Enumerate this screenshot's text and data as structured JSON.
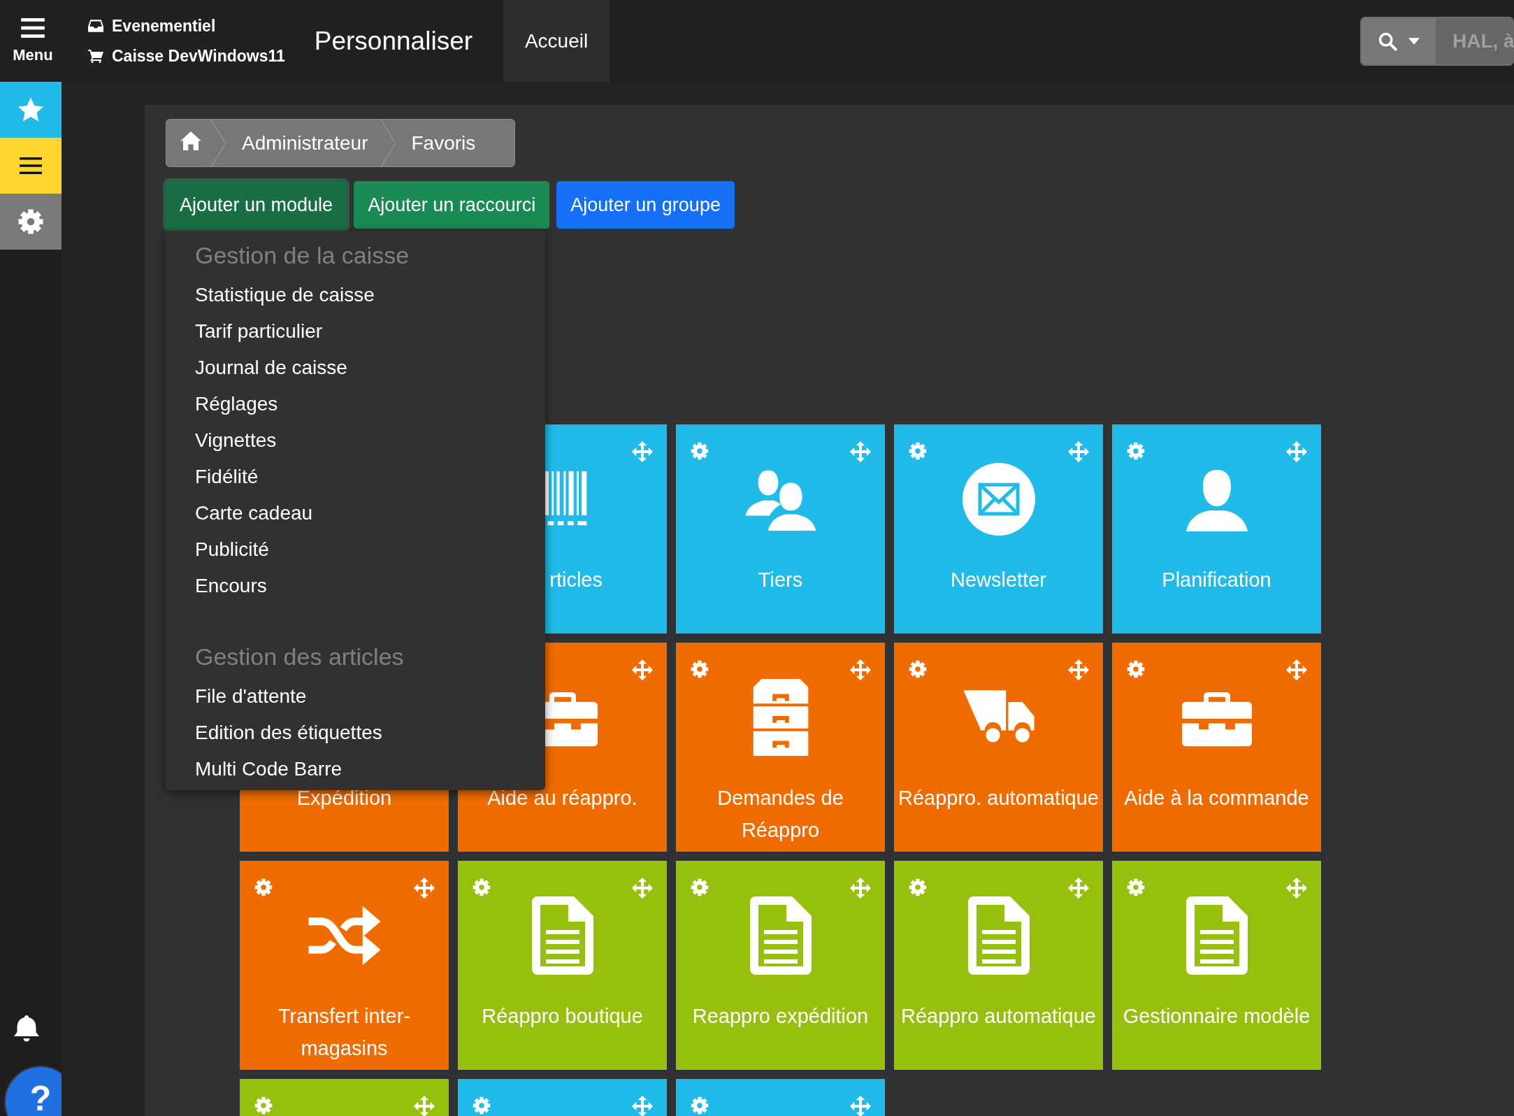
{
  "topbar": {
    "menu_label": "Menu",
    "context": [
      {
        "kind": "inbox",
        "text": "Evenementiel"
      },
      {
        "kind": "cart",
        "text": "Caisse DevWindows11"
      }
    ],
    "title": "Personnaliser",
    "tab": "Accueil",
    "search": {
      "placeholder": "HAL, à"
    }
  },
  "sidebar": {
    "items": [
      {
        "kind": "star",
        "color": "#20bbe8"
      },
      {
        "kind": "menu",
        "color": "#fed531"
      },
      {
        "kind": "gear",
        "color": "#7a7a7a"
      }
    ],
    "help": "?"
  },
  "breadcrumb": [
    "Administrateur",
    "Favoris"
  ],
  "buttons": [
    {
      "label": "Ajouter un module",
      "color": "#1a6e45",
      "selected": true
    },
    {
      "label": "Ajouter un raccourci",
      "color": "#1b8a55",
      "selected": false
    },
    {
      "label": "Ajouter un groupe",
      "color": "#1570f5",
      "selected": false
    }
  ],
  "dropdown": {
    "groups": [
      {
        "title": "Gestion de la caisse",
        "items": [
          "Statistique de caisse",
          "Tarif particulier",
          "Journal de caisse",
          "Réglages",
          "Vignettes",
          "Fidélité",
          "Carte cadeau",
          "Publicité",
          "Encours"
        ]
      },
      {
        "title": "Gestion des articles",
        "items": [
          "File d'attente",
          "Edition des étiquettes",
          "Multi Code Barre"
        ]
      }
    ]
  },
  "tile_rows": [
    [
      null,
      {
        "color": "#20bbe8",
        "kind": "barcode",
        "label": "rticles",
        "label_right": true,
        "gear": false,
        "move": true
      },
      {
        "color": "#20bbe8",
        "kind": "users",
        "label": "Tiers",
        "gear": true,
        "move": true
      },
      {
        "color": "#20bbe8",
        "kind": "envelope",
        "label": "Newsletter",
        "gear": true,
        "move": true
      },
      {
        "color": "#20bbe8",
        "kind": "user",
        "label": "Planification",
        "gear": true,
        "move": true
      }
    ],
    [
      {
        "color": "#f06c00",
        "label": "Expédition"
      },
      {
        "color": "#f06c00",
        "kind": "briefcase",
        "label": "Aide au réappro.",
        "gear": false,
        "move": true
      },
      {
        "color": "#f06c00",
        "kind": "cabinet",
        "label": "Demandes de Réappro",
        "gear": true,
        "move": true
      },
      {
        "color": "#f06c00",
        "kind": "truck",
        "label": "Réappro. automatique",
        "gear": true,
        "move": true
      },
      {
        "color": "#f06c00",
        "kind": "briefcase",
        "label": "Aide à la commande",
        "gear": true,
        "move": true
      }
    ],
    [
      {
        "color": "#f06c00",
        "kind": "shuffle",
        "label": "Transfert inter-magasins",
        "gear": true,
        "move": true
      },
      {
        "color": "#97c00e",
        "kind": "document",
        "label": "Réappro boutique",
        "gear": true,
        "move": true
      },
      {
        "color": "#97c00e",
        "kind": "document",
        "label": "Reappro expédition",
        "gear": true,
        "move": true
      },
      {
        "color": "#97c00e",
        "kind": "document",
        "label": "Réappro automatique",
        "gear": true,
        "move": true
      },
      {
        "color": "#97c00e",
        "kind": "document",
        "label": "Gestionnaire modèle",
        "gear": true,
        "move": true
      }
    ],
    [
      {
        "color": "#97c00e",
        "gear": true,
        "move": true
      },
      {
        "color": "#20bbe8",
        "gear": true,
        "move": true
      },
      {
        "color": "#20bbe8",
        "gear": true,
        "move": true
      }
    ]
  ]
}
